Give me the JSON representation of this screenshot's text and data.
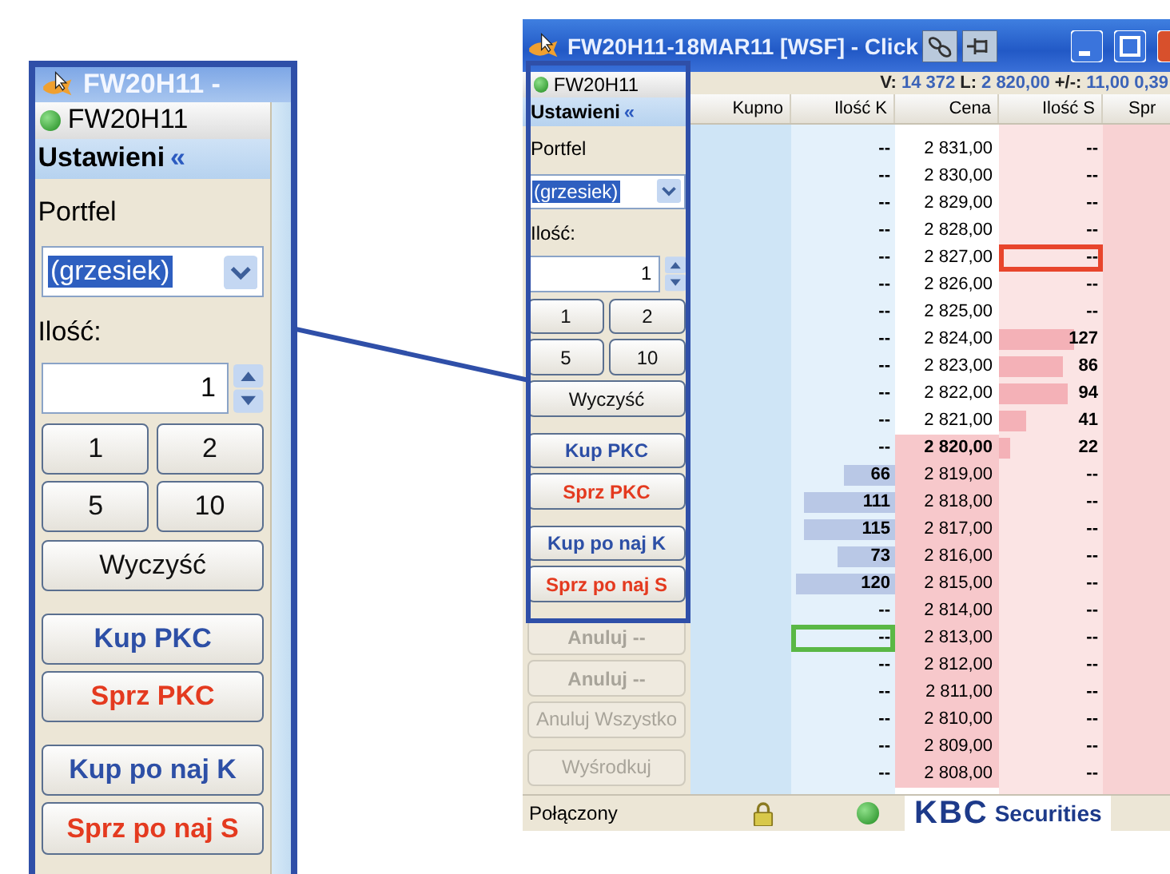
{
  "callout": {
    "title": "FW20H11 -",
    "panel": {
      "instrument": "FW20H11",
      "settings_title": "Ustawieni",
      "collapse": "«",
      "portfolio_label": "Portfel",
      "portfolio": "(grzesiek)",
      "highlighted": true,
      "quantity_label": "Ilość:",
      "quantity": "1",
      "quick": [
        "1",
        "2",
        "5",
        "10"
      ],
      "clear": "Wyczyść",
      "actions": [
        {
          "label": "Kup PKC",
          "kind": "buy"
        },
        {
          "label": "Sprz PKC",
          "kind": "sell"
        },
        {
          "label": "Kup po naj K",
          "kind": "buy"
        },
        {
          "label": "Sprz po naj S",
          "kind": "sell"
        }
      ]
    }
  },
  "window": {
    "title": "FW20H11-18MAR11 [WSF] - Click",
    "panel": {
      "instrument": "FW20H11",
      "settings_title": "Ustawieni",
      "collapse": "«",
      "portfolio_label": "Portfel",
      "portfolio": "(grzesiek)",
      "highlighted": true,
      "quantity_label": "Ilość:",
      "quantity": "1",
      "quick": [
        "1",
        "2",
        "5",
        "10"
      ],
      "clear": "Wyczyść",
      "actions": [
        {
          "label": "Kup PKC",
          "kind": "buy"
        },
        {
          "label": "Sprz PKC",
          "kind": "sell"
        },
        {
          "label": "Kup po naj K",
          "kind": "buy"
        },
        {
          "label": "Sprz po naj S",
          "kind": "sell"
        }
      ],
      "extra": [
        {
          "label": "Anuluj --",
          "kind": "cancel",
          "disabled": true
        },
        {
          "label": "Anuluj --",
          "kind": "cancel",
          "disabled": true
        },
        {
          "label": "Anuluj Wszystko",
          "kind": "cancel",
          "disabled": true
        },
        {
          "label": "Wyśrodkuj",
          "kind": "center",
          "disabled": true
        }
      ]
    },
    "stats": [
      {
        "label": "V:",
        "value": "14 372"
      },
      {
        "label": "L:",
        "value": "2 820,00"
      },
      {
        "label": "+/-:",
        "value": "11,00"
      }
    ],
    "stats_tail": "0,39",
    "columns": [
      "Kupno",
      "Ilość K",
      "Cena",
      "Ilość S",
      "Spr"
    ],
    "rows": [
      {
        "price": "2 831,00",
        "buy": {
          "qty": "--"
        },
        "sell": {
          "qty": "--"
        },
        "shaded": false
      },
      {
        "price": "2 830,00",
        "buy": {
          "qty": "--"
        },
        "sell": {
          "qty": "--"
        },
        "shaded": false
      },
      {
        "price": "2 829,00",
        "buy": {
          "qty": "--"
        },
        "sell": {
          "qty": "--"
        },
        "shaded": false
      },
      {
        "price": "2 828,00",
        "buy": {
          "qty": "--"
        },
        "sell": {
          "qty": "--"
        },
        "shaded": false
      },
      {
        "price": "2 827,00",
        "buy": {
          "qty": "--"
        },
        "sell": {
          "qty": "--",
          "color": "#e8452c"
        },
        "shaded": false
      },
      {
        "price": "2 826,00",
        "buy": {
          "qty": "--"
        },
        "sell": {
          "qty": "--"
        },
        "shaded": false
      },
      {
        "price": "2 825,00",
        "buy": {
          "qty": "--"
        },
        "sell": {
          "qty": "--"
        },
        "shaded": false
      },
      {
        "price": "2 824,00",
        "buy": {
          "qty": "--"
        },
        "sell": {
          "qty": "127",
          "level": 0.72
        },
        "shaded": false
      },
      {
        "price": "2 823,00",
        "buy": {
          "qty": "--"
        },
        "sell": {
          "qty": "86",
          "level": 0.62
        },
        "shaded": false
      },
      {
        "price": "2 822,00",
        "buy": {
          "qty": "--"
        },
        "sell": {
          "qty": "94",
          "level": 0.66
        },
        "shaded": false
      },
      {
        "price": "2 821,00",
        "buy": {
          "qty": "--"
        },
        "sell": {
          "qty": "41",
          "level": 0.26
        },
        "shaded": false
      },
      {
        "price": "2 820,00",
        "current": true,
        "buy": {
          "qty": "--"
        },
        "sell": {
          "qty": "22",
          "level": 0.11
        },
        "shaded": true
      },
      {
        "price": "2 819,00",
        "buy": {
          "qty": "66",
          "level": 0.5
        },
        "sell": {
          "qty": "--"
        },
        "shaded": true
      },
      {
        "price": "2 818,00",
        "buy": {
          "qty": "111",
          "level": 0.87
        },
        "sell": {
          "qty": "--"
        },
        "shaded": true
      },
      {
        "price": "2 817,00",
        "buy": {
          "qty": "115",
          "level": 0.87
        },
        "sell": {
          "qty": "--"
        },
        "shaded": true
      },
      {
        "price": "2 816,00",
        "buy": {
          "qty": "73",
          "level": 0.56
        },
        "sell": {
          "qty": "--"
        },
        "shaded": true
      },
      {
        "price": "2 815,00",
        "buy": {
          "qty": "120",
          "level": 0.95
        },
        "sell": {
          "qty": "--"
        },
        "shaded": true
      },
      {
        "price": "2 814,00",
        "buy": {
          "qty": "--"
        },
        "sell": {
          "qty": "--"
        },
        "shaded": true
      },
      {
        "price": "2 813,00",
        "buy": {
          "qty": "--",
          "color": "#5ab845"
        },
        "sell": {
          "qty": "--"
        },
        "shaded": true
      },
      {
        "price": "2 812,00",
        "buy": {
          "qty": "--"
        },
        "sell": {
          "qty": "--"
        },
        "shaded": true
      },
      {
        "price": "2 811,00",
        "buy": {
          "qty": "--"
        },
        "sell": {
          "qty": "--"
        },
        "shaded": true
      },
      {
        "price": "2 810,00",
        "buy": {
          "qty": "--"
        },
        "sell": {
          "qty": "--"
        },
        "shaded": true
      },
      {
        "price": "2 809,00",
        "buy": {
          "qty": "--"
        },
        "sell": {
          "qty": "--"
        },
        "shaded": true
      },
      {
        "price": "2 808,00",
        "buy": {
          "qty": "--"
        },
        "sell": {
          "qty": "--"
        },
        "shaded": true
      }
    ],
    "status_bar": {
      "text": "Połączony",
      "logo": {
        "brand": "KBC",
        "tagline": "Securities"
      }
    }
  }
}
